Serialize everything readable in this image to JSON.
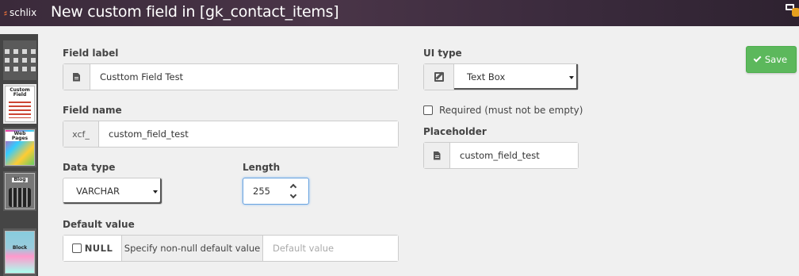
{
  "app": {
    "logo_text": "schlix"
  },
  "header": {
    "title": "New custom field in [gk_contact_items]"
  },
  "sidebar": {
    "items": [
      {
        "name": "apps-grid-icon"
      },
      {
        "label": "Custom Field"
      },
      {
        "label": "Web Pages"
      },
      {
        "label": "Blog"
      },
      {
        "label": "Block"
      }
    ]
  },
  "form": {
    "field_label": {
      "label": "Field label",
      "value": "Custtom Field Test"
    },
    "field_name": {
      "label": "Field name",
      "prefix": "xcf_",
      "value": "custom_field_test"
    },
    "data_type": {
      "label": "Data type",
      "selected": "VARCHAR"
    },
    "length": {
      "label": "Length",
      "value": "255"
    },
    "default_value": {
      "label": "Default value",
      "null_label": "NULL",
      "specify_label": "Specify non-null default value",
      "placeholder": "Default value"
    },
    "ui_type": {
      "label": "UI type",
      "selected": "Text Box"
    },
    "required": {
      "label": "Required (must not be empty)",
      "checked": false
    },
    "placeholder": {
      "label": "Placeholder",
      "value": "custom_field_test"
    }
  },
  "actions": {
    "save_label": "Save"
  },
  "colors": {
    "save": "#5cb85c",
    "topbar": "#3a2a3a",
    "rail": "#454545"
  }
}
